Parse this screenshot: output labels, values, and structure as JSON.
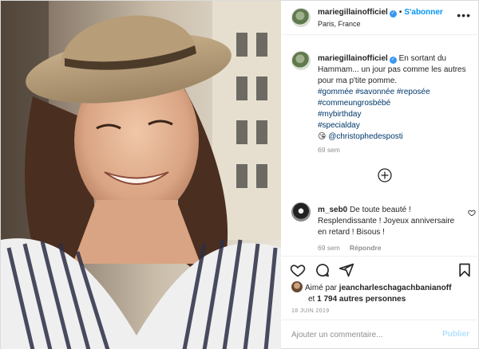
{
  "post": {
    "photo_alt": "",
    "header": {
      "username": "mariegillainofficiel",
      "separator": "•",
      "follow_label": "S'abonner",
      "location": "Paris, France"
    },
    "caption": {
      "username": "mariegillainofficiel",
      "text": "En sortant du Hammam... un jour pas comme les autres pour ma p'tite pomme.",
      "hashtags": [
        "#gommée #savonnée #reposée",
        "#commeungrosbébé",
        "#mybirthday",
        "#specialday"
      ],
      "mention_emoji": "😘",
      "mention": "@christophedesposti",
      "time": "69 sem"
    },
    "comment": {
      "username": "m_seb0",
      "text": "De toute beauté ! Resplendissante ! Joyeux anniversaire en retard ! Bisous !",
      "time": "69 sem",
      "reply_label": "Répondre"
    },
    "likes": {
      "prefix": "Aimé par",
      "first_user": "jeancharleschagachbanianoff",
      "conjunction": "et",
      "others": "1 794 autres personnes"
    },
    "date": "18 JUIN 2019",
    "add_comment": {
      "placeholder": "Ajouter un commentaire...",
      "publish_label": "Publier"
    },
    "icons": {
      "more": "more-options-icon",
      "like": "heart-icon",
      "comment": "comment-icon",
      "share": "share-icon",
      "save": "bookmark-icon",
      "load_more": "plus-circle-icon"
    },
    "colors": {
      "link_blue": "#0095f6",
      "hashtag_blue": "#00376b",
      "muted": "#8e8e8e",
      "publish_disabled": "#b2dffc"
    }
  }
}
